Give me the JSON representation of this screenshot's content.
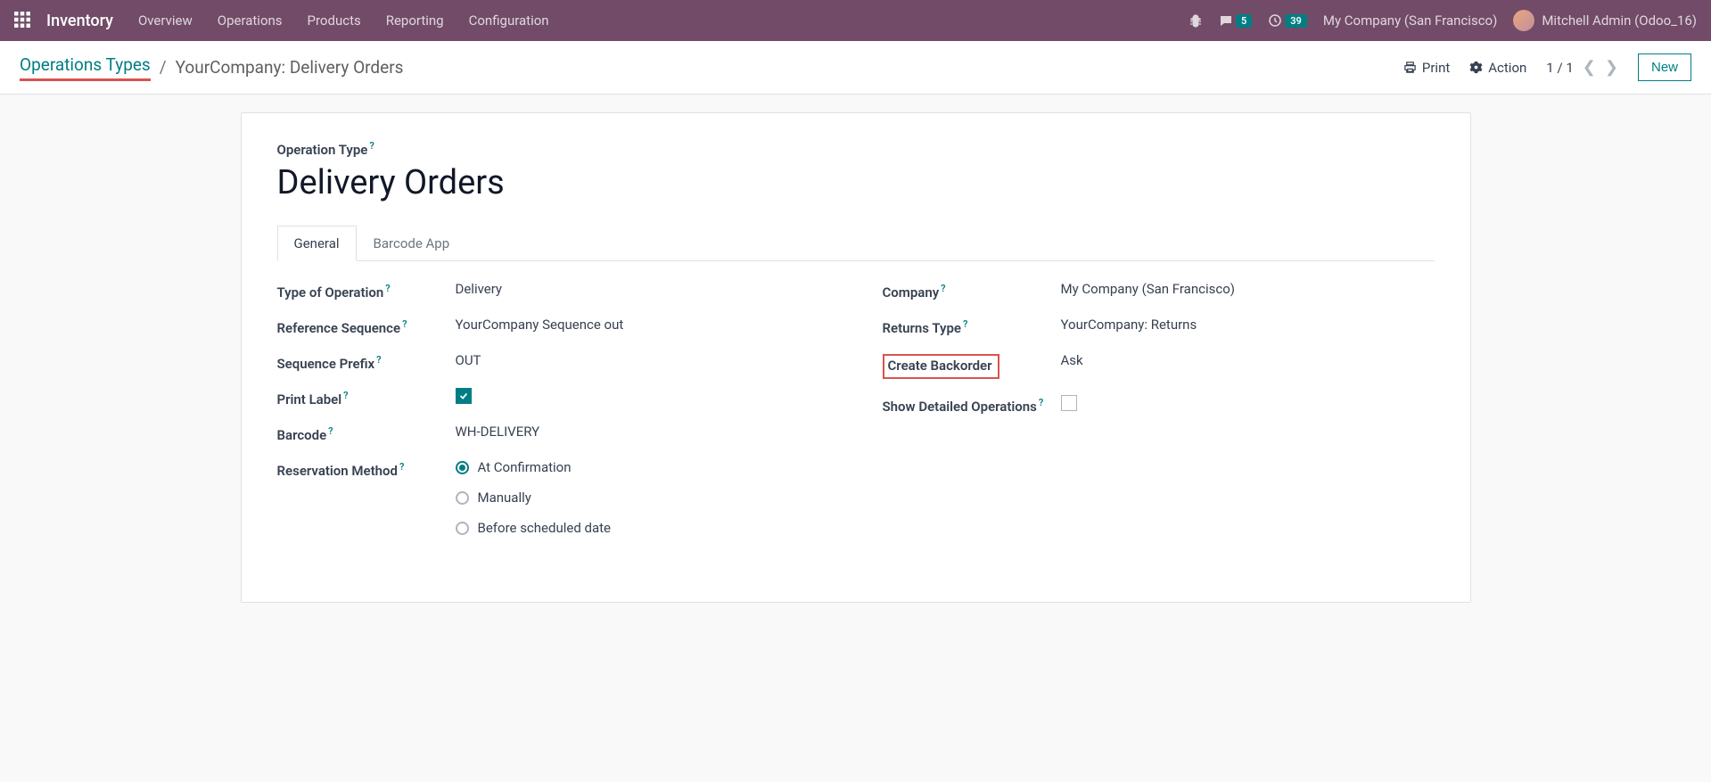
{
  "nav": {
    "app": "Inventory",
    "items": [
      "Overview",
      "Operations",
      "Products",
      "Reporting",
      "Configuration"
    ],
    "msg_count": "5",
    "activity_count": "39",
    "company": "My Company (San Francisco)",
    "user": "Mitchell Admin (Odoo_16)"
  },
  "controlbar": {
    "bc_link": "Operations Types",
    "bc_sep": "/",
    "bc_current": "YourCompany: Delivery Orders",
    "print": "Print",
    "action": "Action",
    "pager": "1 / 1",
    "new": "New"
  },
  "form": {
    "title_label": "Operation Type",
    "title_value": "Delivery Orders",
    "tabs": [
      "General",
      "Barcode App"
    ],
    "left": {
      "type_op_label": "Type of Operation",
      "type_op_value": "Delivery",
      "ref_seq_label": "Reference Sequence",
      "ref_seq_value": "YourCompany Sequence out",
      "seq_prefix_label": "Sequence Prefix",
      "seq_prefix_value": "OUT",
      "print_label_label": "Print Label",
      "barcode_label": "Barcode",
      "barcode_value": "WH-DELIVERY",
      "res_method_label": "Reservation Method",
      "res_options": [
        "At Confirmation",
        "Manually",
        "Before scheduled date"
      ]
    },
    "right": {
      "company_label": "Company",
      "company_value": "My Company (San Francisco)",
      "returns_label": "Returns Type",
      "returns_value": "YourCompany: Returns",
      "backorder_label": "Create Backorder",
      "backorder_value": "Ask",
      "detailed_label": "Show Detailed Operations"
    }
  }
}
